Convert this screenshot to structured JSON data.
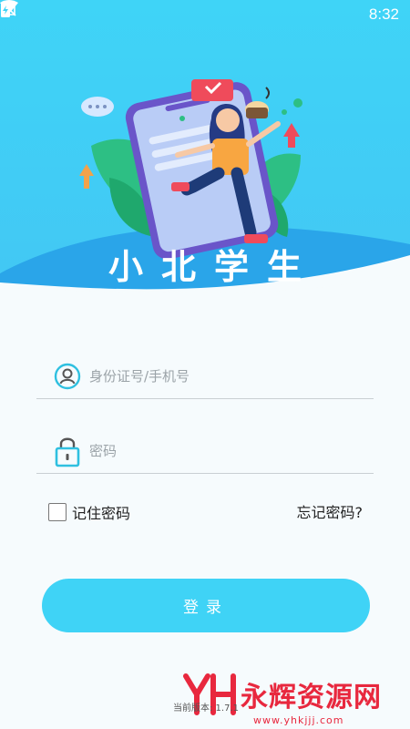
{
  "status_bar": {
    "time": "8:32",
    "icons": [
      "wifi-icon",
      "no-sim-icon",
      "battery-charging-icon"
    ]
  },
  "header": {
    "app_title": "小北学生",
    "colors": {
      "sky_top": "#3fd3f6",
      "sky_bottom": "#40c6f2",
      "wave": "#2aa6ea"
    }
  },
  "form": {
    "username_placeholder": "身份证号/手机号",
    "password_placeholder": "密码",
    "remember_label": "记住密码",
    "forgot_label": "忘记密码?",
    "login_label": "登录"
  },
  "footer": {
    "version_text": "当前版本: 1.7.1"
  },
  "watermark": {
    "text": "永辉资源网",
    "url": "www.yhkjjj.com"
  },
  "colors": {
    "accent": "#3fd3f6",
    "icon": "#2fc0e0",
    "watermark": "#e8283e"
  }
}
